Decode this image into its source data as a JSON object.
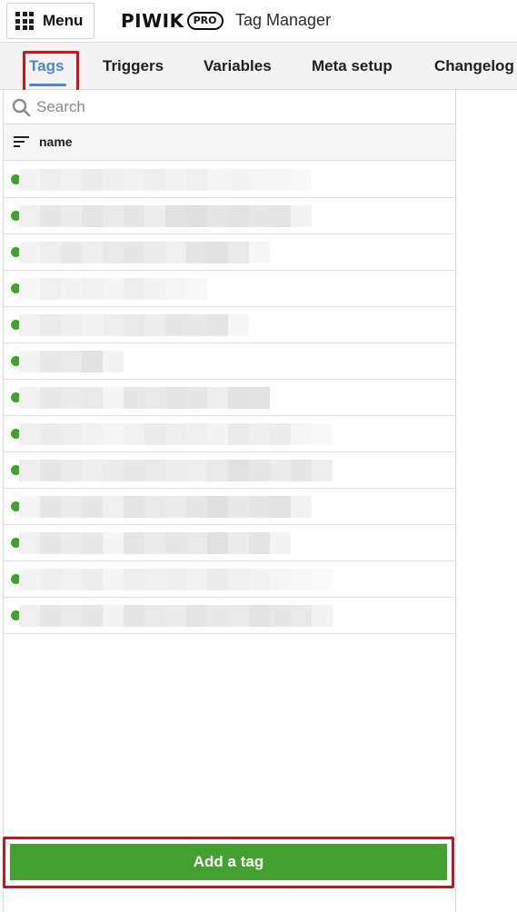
{
  "header": {
    "menu_label": "Menu",
    "menu_icon": "grid-icon",
    "logo_word": "PIWIK",
    "logo_badge": "PRO",
    "app_name": "Tag Manager"
  },
  "tabs": [
    {
      "label": "Tags",
      "active": true
    },
    {
      "label": "Triggers",
      "active": false
    },
    {
      "label": "Variables",
      "active": false
    },
    {
      "label": "Meta setup",
      "active": false
    },
    {
      "label": "Changelog",
      "active": false
    }
  ],
  "search": {
    "placeholder": "Search",
    "value": "",
    "icon": "search-icon"
  },
  "list": {
    "column_header": "name",
    "sort_icon": "sort-icon",
    "row_count_visible": 13,
    "row_status": "active",
    "row_names_blurred": true
  },
  "footer": {
    "add_label": "Add a tag"
  },
  "colors": {
    "accent_blue": "#4f86c9",
    "status_green": "#43a12f",
    "button_green": "#43a12f",
    "highlight_red": "#c8141b"
  }
}
